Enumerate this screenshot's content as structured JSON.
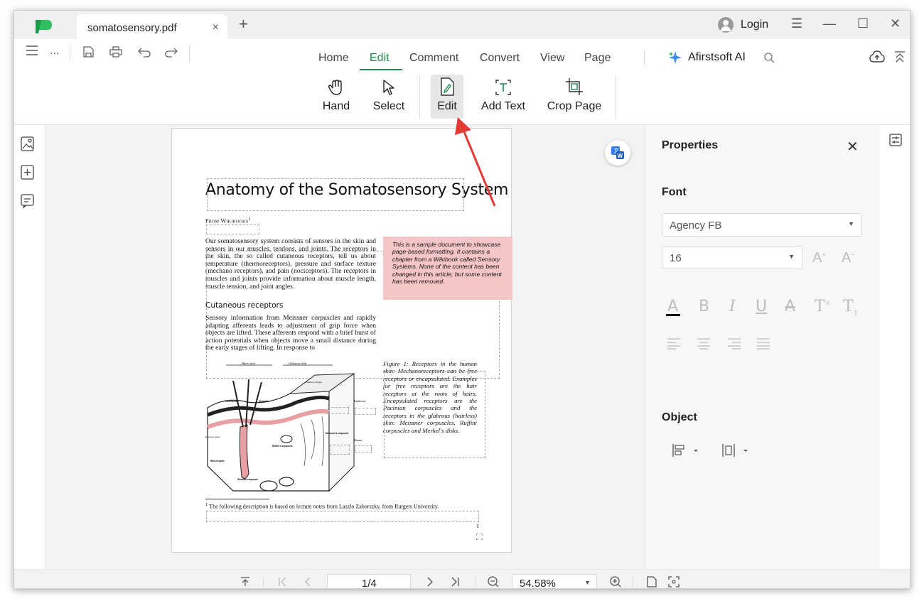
{
  "titlebar": {
    "tab_title": "somatosensory.pdf",
    "tab_close": "×",
    "new_tab": "+",
    "login_label": "Login",
    "menu_icon": "☰",
    "minimize": "—",
    "maximize": "☐",
    "close": "✕"
  },
  "quickbar": {
    "more": "..."
  },
  "menu": {
    "tabs": [
      "Home",
      "Edit",
      "Comment",
      "Convert",
      "View",
      "Page"
    ],
    "active": "Edit",
    "ai_label": "Afirstsoft AI"
  },
  "tools": [
    {
      "label": "Hand",
      "icon": "hand-icon"
    },
    {
      "label": "Select",
      "icon": "cursor-icon"
    },
    {
      "label": "Edit",
      "icon": "edit-icon"
    },
    {
      "label": "Add Text",
      "icon": "add-text-icon"
    },
    {
      "label": "Crop Page",
      "icon": "crop-icon"
    }
  ],
  "document": {
    "title": "Anatomy of the Somatosensory System",
    "from": "From Wikibooks",
    "from_sup": "1",
    "para1": "Our somatosensory system consists of sensors in the skin and sensors in our muscles, tendons, and joints. The receptors in the skin, the so called cutaneous receptors, tell us about temperature (thermoreceptors), pressure and surface texture (mechano receptors), and pain (nociceptors). The receptors in muscles and joints provide information about muscle length, muscle tension, and joint angles.",
    "note": "This is a sample document to showcase page-based formatting. It contains a chapter from a Wikibook called Sensory Systems. None of the content has been changed in this article, but some content has been removed.",
    "subheading": "Cutaneous receptors",
    "para2": "Sensory information from Meissner corpuscles and rapidly adapting afferents leads to adjustment of grip force when objects are lifted. These afferents respond with a brief burst of action potentials when objects move a small distance during the early stages of lifting. In response to",
    "figure_caption": "Figure 1: Receptors in the human skin: Mechanoreceptors can be free receptors or encapsulated. Examples for free receptors are the hair receptors at the roots of hairs. Encapsulated receptors are the Pacinian corpuscles and the receptors in the glabrous (hairless) skin: Meissner corpuscles, Ruffini corpuscles and Merkel's disks.",
    "figure_labels": {
      "hairy": "Hairy skin",
      "glabrous": "Glabrous skin",
      "papillary": "Papillary Ridges",
      "epidermis": "Epidermis",
      "dermis": "Dermis",
      "free_nerve": "Free nerve",
      "merkels": "Merkel's",
      "meissners": "Meissner's corpuscle",
      "ruffini": "Ruffini's corpuscle",
      "sebaceous": "Sebaceous gland",
      "hair_receptor": "Hair receptor",
      "pacinian": "Pacinian corpuscle"
    },
    "footnote_sup": "1",
    "footnote": "The following description is based on lecture notes from Laszlo Zaborszky, from Rutgers University.",
    "page_number": "1"
  },
  "properties": {
    "title": "Properties",
    "close": "✕",
    "font_section": "Font",
    "font_family": "Agency FB",
    "font_size": "16",
    "object_section": "Object"
  },
  "statusbar": {
    "page_input": "1/4",
    "zoom": "54.58%"
  },
  "colors": {
    "accent": "#1f8a4c",
    "logo": "#2fbf5f",
    "note_bg": "#f6c6c7",
    "arrow": "#e53935"
  }
}
